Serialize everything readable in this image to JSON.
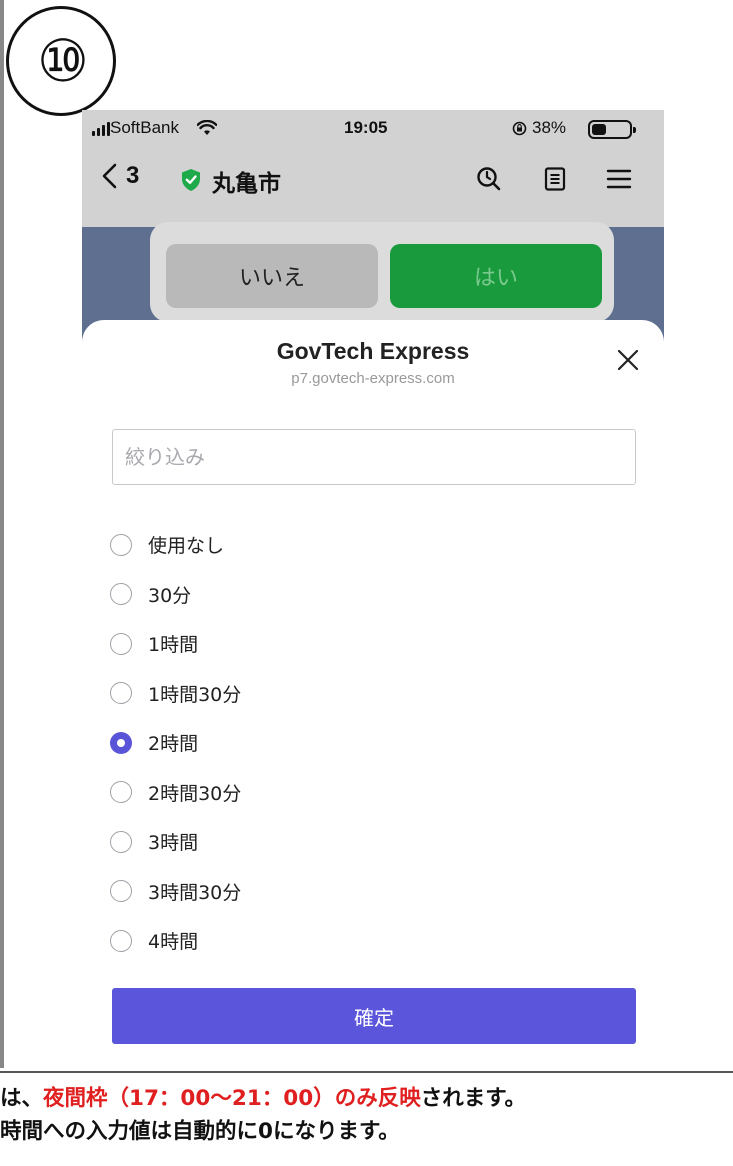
{
  "step_badge": "⑩",
  "status_bar": {
    "carrier": "SoftBank",
    "time": "19:05",
    "battery": "38%",
    "battery_level": 0.38
  },
  "nav": {
    "back_count": "3",
    "site_title": "丸亀市"
  },
  "background_dialog": {
    "no_label": "いいえ",
    "yes_label": "はい"
  },
  "sheet": {
    "title": "GovTech Express",
    "url": "p7.govtech-express.com",
    "filter_placeholder": "絞り込み",
    "filter_value": "",
    "options": [
      {
        "label": "使用なし",
        "selected": false
      },
      {
        "label": "30分",
        "selected": false
      },
      {
        "label": "1時間",
        "selected": false
      },
      {
        "label": "1時間30分",
        "selected": false
      },
      {
        "label": "2時間",
        "selected": true
      },
      {
        "label": "2時間30分",
        "selected": false
      },
      {
        "label": "3時間",
        "selected": false
      },
      {
        "label": "3時間30分",
        "selected": false
      },
      {
        "label": "4時間",
        "selected": false
      }
    ],
    "confirm_label": "確定"
  },
  "caption": {
    "line1_prefix": "は、",
    "line1_highlight": "夜間枠（17：00〜21：00）のみ反映",
    "line1_suffix": "されます。",
    "line2": "時間への入力値は自動的に0になります。"
  },
  "colors": {
    "accent": "#5b55db",
    "yes_green": "#199a3c",
    "highlight_red": "#e02020"
  }
}
